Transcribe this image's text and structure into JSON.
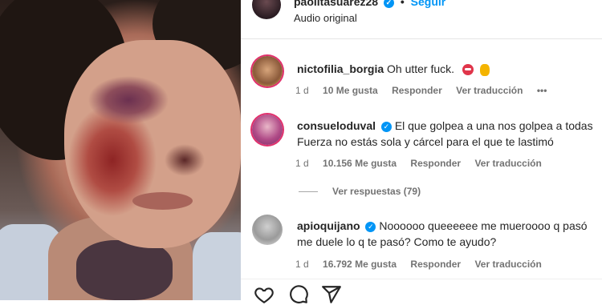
{
  "post": {
    "username": "paolitasuarez28",
    "follow_label": "Seguir",
    "dot": "•",
    "audio": "Audio original"
  },
  "comments": [
    {
      "username": "nictofilia_borgia",
      "verified": false,
      "text": "Oh utter fuck.",
      "emojis": [
        "red-face-emoji",
        "raised-finger-emoji"
      ],
      "time": "1 d",
      "likes": "10 Me gusta",
      "reply_label": "Responder",
      "translate_label": "Ver traducción",
      "more_label": "•••"
    },
    {
      "username": "consueloduval",
      "verified": true,
      "text_line1": "El que golpea a una nos golpea a todas",
      "text_line2": "Fuerza no estás sola y cárcel para el que te lastimó",
      "time": "1 d",
      "likes": "10.156 Me gusta",
      "reply_label": "Responder",
      "translate_label": "Ver traducción",
      "view_replies": "Ver respuestas (79)"
    },
    {
      "username": "apioquijano",
      "verified": true,
      "text_line1": "Noooooo queeeeee me mueroooo q pasó",
      "text_line2": "me duele lo q te pasó? Como te ayudo?",
      "time": "1 d",
      "likes": "16.792 Me gusta",
      "reply_label": "Responder",
      "translate_label": "Ver traducción"
    }
  ],
  "icons": {
    "like": "heart-icon",
    "comment": "comment-icon",
    "share": "send-icon",
    "verified": "verified-badge-icon"
  },
  "colors": {
    "accent": "#0095f6",
    "meta_text": "#737373",
    "text": "#262626"
  }
}
